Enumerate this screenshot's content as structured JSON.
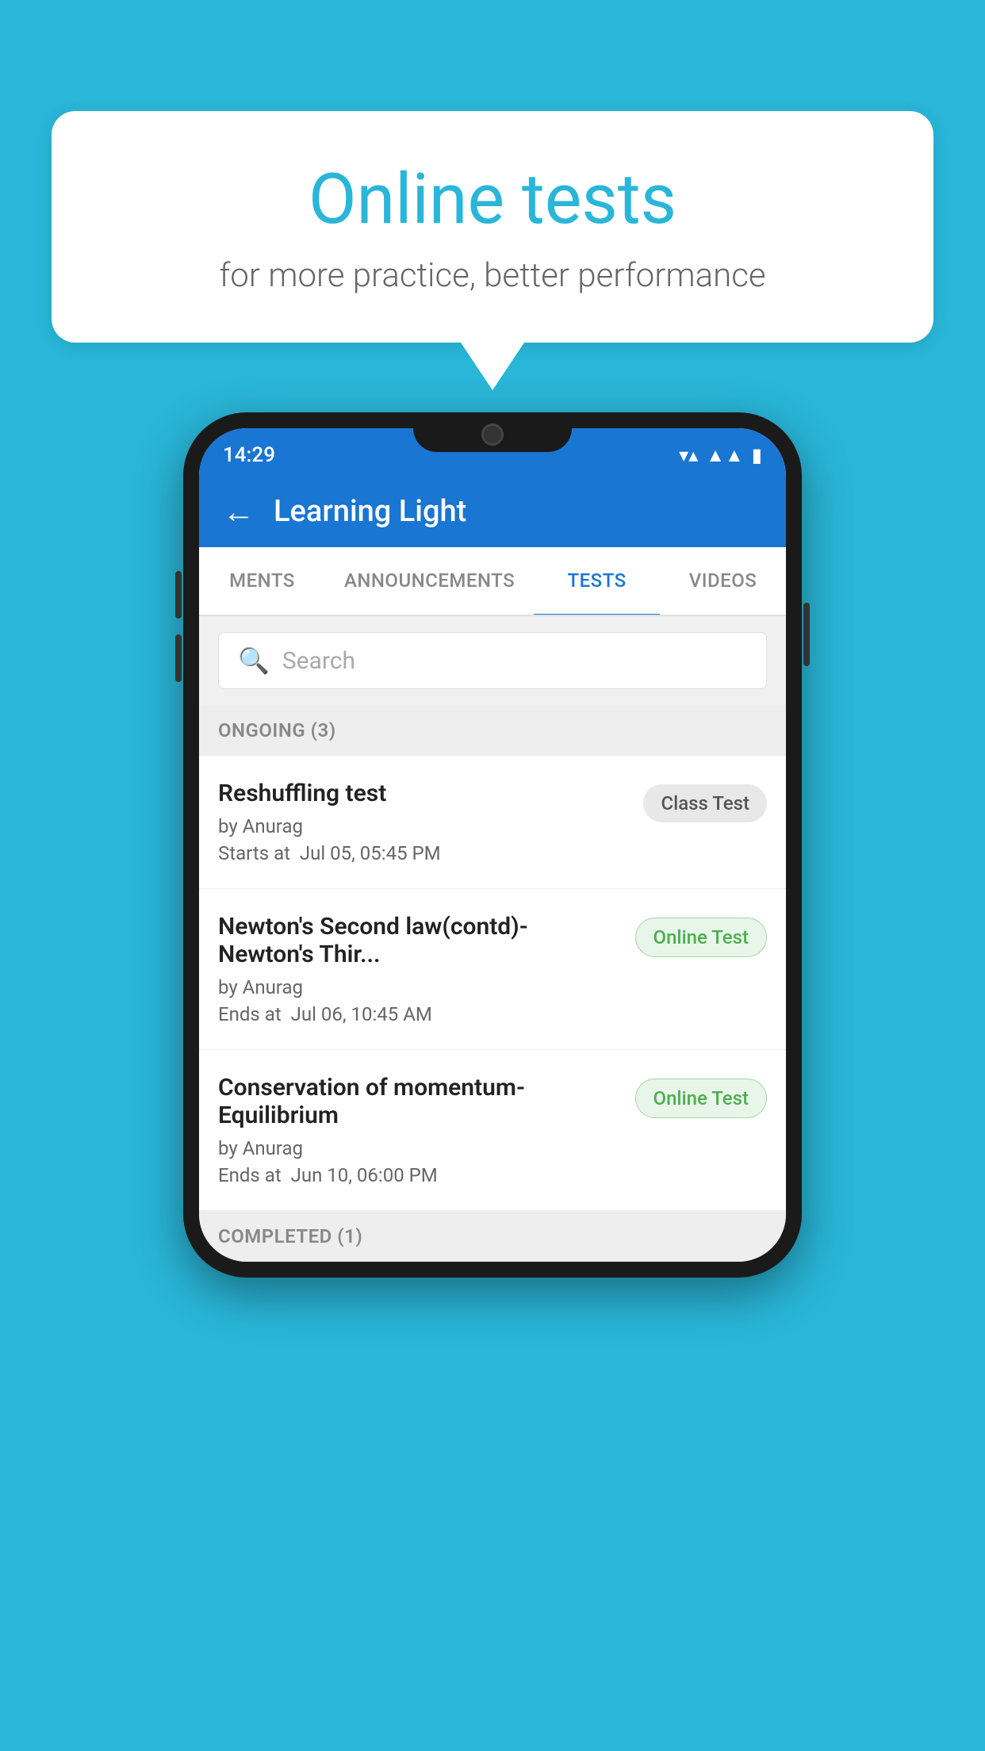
{
  "background_color": "#29b6d8",
  "speech_bubble": {
    "title": "Online tests",
    "subtitle": "for more practice, better performance"
  },
  "status_bar": {
    "time": "14:29",
    "wifi": "▼",
    "signal": "◀",
    "battery": "▮"
  },
  "app_header": {
    "back_label": "←",
    "title": "Learning Light"
  },
  "tabs": [
    {
      "label": "MENTS",
      "active": false
    },
    {
      "label": "ANNOUNCEMENTS",
      "active": false
    },
    {
      "label": "TESTS",
      "active": true
    },
    {
      "label": "VIDEOS",
      "active": false
    }
  ],
  "search": {
    "placeholder": "Search"
  },
  "ongoing_section": {
    "title": "ONGOING (3)"
  },
  "tests": [
    {
      "name": "Reshuffling test",
      "author": "by Anurag",
      "time_label": "Starts at",
      "time_value": "Jul 05, 05:45 PM",
      "badge": "Class Test",
      "badge_type": "class"
    },
    {
      "name": "Newton's Second law(contd)-Newton's Thir...",
      "author": "by Anurag",
      "time_label": "Ends at",
      "time_value": "Jul 06, 10:45 AM",
      "badge": "Online Test",
      "badge_type": "online"
    },
    {
      "name": "Conservation of momentum-Equilibrium",
      "author": "by Anurag",
      "time_label": "Ends at",
      "time_value": "Jun 10, 06:00 PM",
      "badge": "Online Test",
      "badge_type": "online"
    }
  ],
  "completed_section": {
    "title": "COMPLETED (1)"
  }
}
